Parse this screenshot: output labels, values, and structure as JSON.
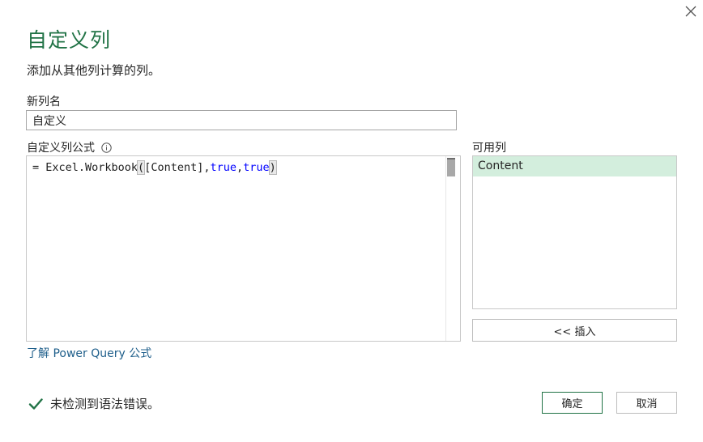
{
  "dialog": {
    "title": "自定义列",
    "subtitle": "添加从其他列计算的列。",
    "close_icon": "close-icon"
  },
  "new_column": {
    "label": "新列名",
    "value": "自定义"
  },
  "formula": {
    "label": "自定义列公式",
    "info_icon": "info-icon",
    "prefix": "= Excel.Workbook",
    "open_paren": "(",
    "arg1": "[Content],",
    "kw1": "true",
    "comma": ",",
    "kw2": "true",
    "close_paren": ")"
  },
  "available_columns": {
    "label": "可用列",
    "items": [
      "Content"
    ]
  },
  "insert_button": "<< 插入",
  "learn_link": "了解 Power Query 公式",
  "status": {
    "icon": "check-icon",
    "text": "未检测到语法错误。"
  },
  "buttons": {
    "ok": "确定",
    "cancel": "取消"
  },
  "colors": {
    "accent": "#217346",
    "selected_item": "#d3eedd",
    "link": "#1f5f8b",
    "keyword": "#0000ff"
  }
}
